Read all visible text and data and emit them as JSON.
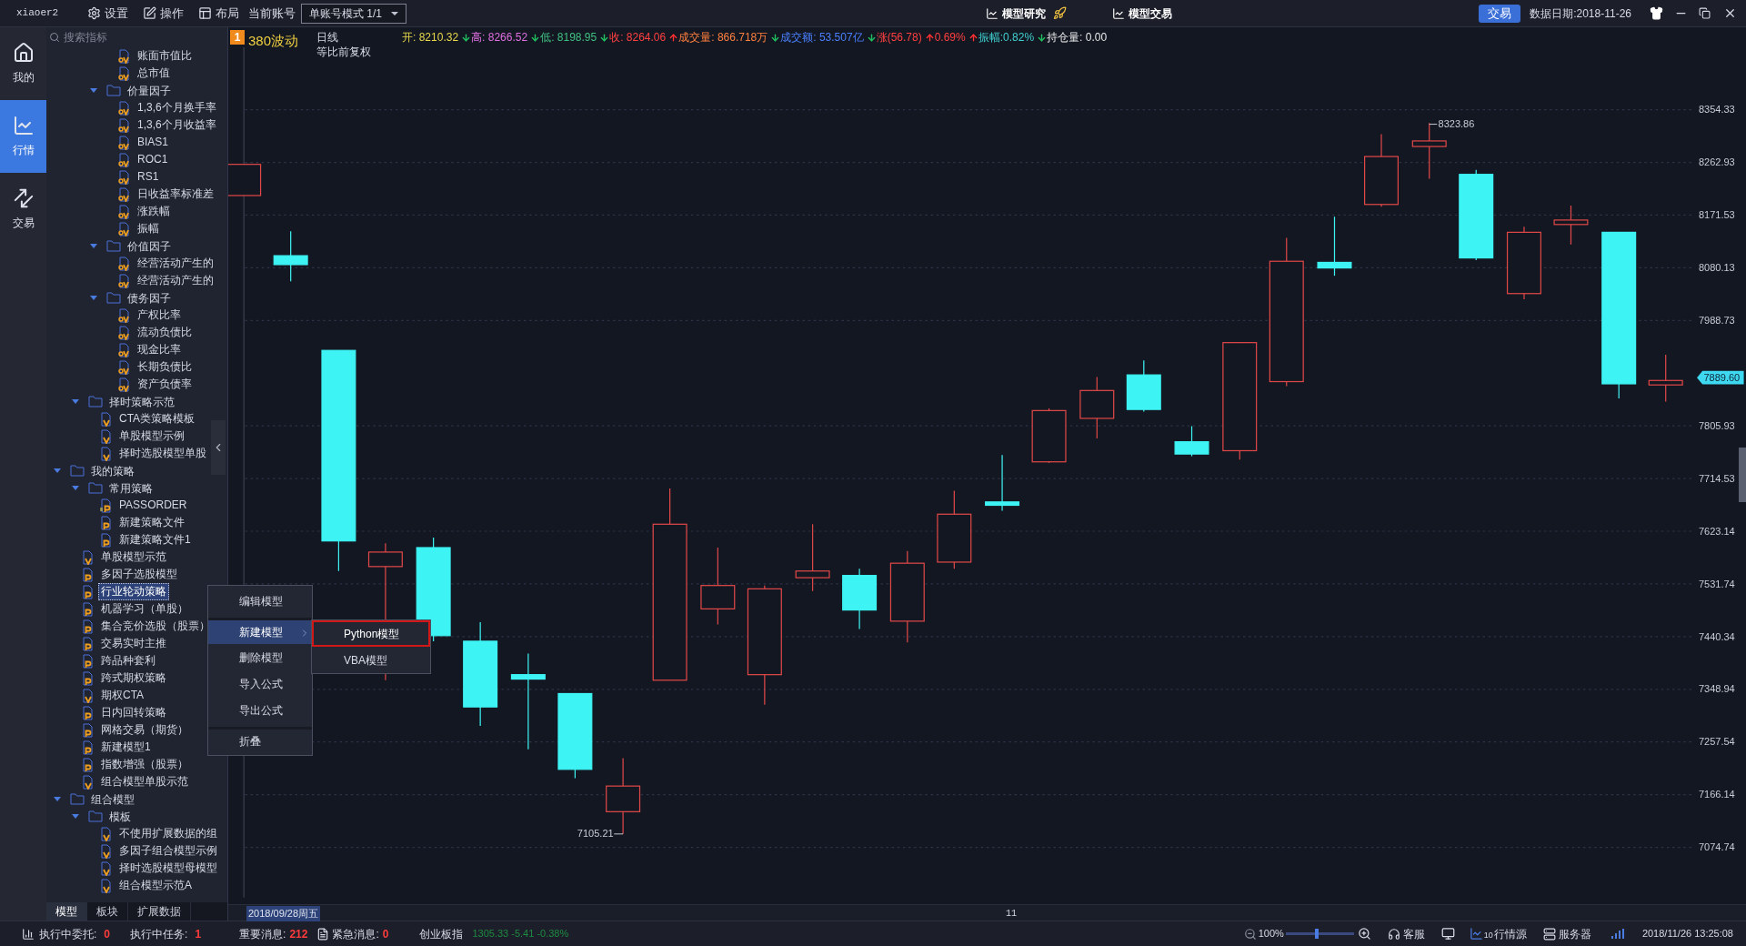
{
  "top_bar": {
    "user": "xiaoer2",
    "menus": [
      {
        "label": "设置"
      },
      {
        "label": "操作"
      },
      {
        "label": "布局"
      }
    ],
    "account_label": "当前账号",
    "account_select": "单账号模式 1/1",
    "center_tabs": [
      "模型研究",
      "模型交易"
    ],
    "trade_button": "交易",
    "data_date": "数据日期:2018-11-26"
  },
  "rail": [
    {
      "label": "我的",
      "selected": false
    },
    {
      "label": "行情",
      "selected": true
    },
    {
      "label": "交易",
      "selected": false
    }
  ],
  "tree": {
    "search_placeholder": "搜索指标",
    "items": [
      {
        "kind": "group",
        "children": [
          {
            "kind": "group",
            "children": [
              {
                "kind": "group",
                "children": [
                  {
                    "kind": "av",
                    "label": "账面市值比",
                    "selected": false
                  },
                  {
                    "kind": "av",
                    "label": "总市值",
                    "selected": false
                  }
                ]
              },
              {
                "kind": "folder",
                "label": "价量因子",
                "expanded": true,
                "children": [
                  {
                    "kind": "av",
                    "label": "1,3,6个月换手率",
                    "selected": false
                  },
                  {
                    "kind": "av",
                    "label": "1,3,6个月收益率",
                    "selected": false
                  },
                  {
                    "kind": "av",
                    "label": "BIAS1",
                    "selected": false
                  },
                  {
                    "kind": "av",
                    "label": "ROC1",
                    "selected": false
                  },
                  {
                    "kind": "av",
                    "label": "RS1",
                    "selected": false
                  },
                  {
                    "kind": "av",
                    "label": "日收益率标准差",
                    "selected": false
                  },
                  {
                    "kind": "av",
                    "label": "涨跌幅",
                    "selected": false
                  },
                  {
                    "kind": "av",
                    "label": "振幅",
                    "selected": false
                  }
                ]
              },
              {
                "kind": "folder",
                "label": "价值因子",
                "expanded": true,
                "children": [
                  {
                    "kind": "av",
                    "label": "经营活动产生的",
                    "selected": false
                  },
                  {
                    "kind": "av",
                    "label": "经营活动产生的",
                    "selected": false
                  }
                ]
              },
              {
                "kind": "folder",
                "label": "债务因子",
                "expanded": true,
                "children": [
                  {
                    "kind": "av",
                    "label": "产权比率",
                    "selected": false
                  },
                  {
                    "kind": "av",
                    "label": "流动负债比",
                    "selected": false
                  },
                  {
                    "kind": "av",
                    "label": "现金比率",
                    "selected": false
                  },
                  {
                    "kind": "av",
                    "label": "长期负债比",
                    "selected": false
                  },
                  {
                    "kind": "av",
                    "label": "资产负债率",
                    "selected": false
                  }
                ]
              }
            ]
          },
          {
            "kind": "folder",
            "label": "择时策略示范",
            "expanded": true,
            "children": [
              {
                "kind": "v",
                "label": "CTA类策略模板",
                "selected": false
              },
              {
                "kind": "v",
                "label": "单股模型示例",
                "selected": false
              },
              {
                "kind": "v",
                "label": "择时选股模型单股",
                "selected": false
              }
            ]
          }
        ]
      },
      {
        "kind": "folder",
        "label": "我的策略",
        "expanded": true,
        "children": [
          {
            "kind": "folder",
            "label": "常用策略",
            "expanded": true,
            "children": [
              {
                "kind": "pe",
                "label": "PASSORDER",
                "selected": false
              },
              {
                "kind": "p",
                "label": "新建策略文件",
                "selected": false
              },
              {
                "kind": "p",
                "label": "新建策略文件1",
                "selected": false
              }
            ]
          },
          {
            "kind": "v",
            "label": "单股模型示范",
            "selected": false
          },
          {
            "kind": "p",
            "label": "多因子选股模型",
            "selected": false
          },
          {
            "kind": "p",
            "label": "行业轮动策略",
            "selected": true
          },
          {
            "kind": "p",
            "label": "机器学习（单股）",
            "selected": false
          },
          {
            "kind": "p",
            "label": "集合竞价选股（股票）",
            "selected": false
          },
          {
            "kind": "p",
            "label": "交易实时主推",
            "selected": false
          },
          {
            "kind": "p",
            "label": "跨品种套利",
            "selected": false
          },
          {
            "kind": "p",
            "label": "跨式期权策略",
            "selected": false
          },
          {
            "kind": "v",
            "label": "期权CTA",
            "selected": false
          },
          {
            "kind": "p",
            "label": "日内回转策略",
            "selected": false
          },
          {
            "kind": "p",
            "label": "网格交易（期货）",
            "selected": false
          },
          {
            "kind": "p",
            "label": "新建模型1",
            "selected": false
          },
          {
            "kind": "p",
            "label": "指数增强（股票）",
            "selected": false
          },
          {
            "kind": "v",
            "label": "组合模型单股示范",
            "selected": false
          }
        ]
      },
      {
        "kind": "folder",
        "label": "组合模型",
        "expanded": true,
        "children": [
          {
            "kind": "folder",
            "label": "模板",
            "expanded": true,
            "children": [
              {
                "kind": "v",
                "label": "不使用扩展数据的组",
                "selected": false
              },
              {
                "kind": "v",
                "label": "多因子组合模型示例",
                "selected": false
              },
              {
                "kind": "v",
                "label": "择时选股模型母模型",
                "selected": false
              },
              {
                "kind": "v",
                "label": "组合模型示范A",
                "selected": false
              }
            ]
          }
        ]
      }
    ]
  },
  "tree_tabs": [
    {
      "label": "模型",
      "selected": true
    },
    {
      "label": "板块",
      "selected": false
    },
    {
      "label": "扩展数据",
      "selected": false
    }
  ],
  "context_menu": [
    {
      "label": "编辑模型",
      "selected": false,
      "has_submenu": false,
      "separator_before": false
    },
    {
      "label": "新建模型",
      "selected": true,
      "has_submenu": true,
      "separator_before": true
    },
    {
      "label": "删除模型",
      "selected": false,
      "has_submenu": false,
      "separator_before": false
    },
    {
      "label": "导入公式",
      "selected": false,
      "has_submenu": false,
      "separator_before": false
    },
    {
      "label": "导出公式",
      "selected": false,
      "has_submenu": false,
      "separator_before": false
    },
    {
      "label": "折叠",
      "selected": false,
      "has_submenu": false,
      "separator_before": true
    }
  ],
  "submenu": [
    {
      "label": "Python模型",
      "selected": true
    },
    {
      "label": "VBA模型",
      "selected": false
    }
  ],
  "chart": {
    "badge": "1",
    "name": "380波动",
    "period": "日线",
    "adjust": "等比前复权",
    "quote": [
      {
        "kind": "plain",
        "text": "开: 8210.32",
        "color": "#e8d84a"
      },
      {
        "kind": "down",
        "text": "高: 8266.52",
        "color": "#e070e0"
      },
      {
        "kind": "down",
        "text": "低: 8198.95",
        "color": "#40c080"
      },
      {
        "kind": "down",
        "text": "收: 8264.06",
        "color": "#ff4040"
      },
      {
        "kind": "up",
        "text": "成交量: 866.718万",
        "color": "#ff8040"
      },
      {
        "kind": "down",
        "text": "成交额: 53.507亿",
        "color": "#4a80ff"
      },
      {
        "kind": "down",
        "text": "涨(56.78)",
        "color": "#ff4040"
      },
      {
        "kind": "up",
        "text": "0.69%",
        "color": "#ff4040"
      },
      {
        "kind": "up",
        "text": "振幅:0.82%",
        "color": "#40d0d0"
      },
      {
        "kind": "down",
        "text": "持仓量: 0.00",
        "color": "#e8e8e8"
      }
    ],
    "price_ticks": [
      "8354.33",
      "8262.93",
      "8171.53",
      "8080.13",
      "7988.73",
      "7805.93",
      "7714.53",
      "7623.14",
      "7531.74",
      "7440.34",
      "7348.94",
      "7257.54",
      "7166.14",
      "7074.74"
    ],
    "high_label": "8323.86",
    "low_label": "7105.21",
    "last_price": "7889.60",
    "date_label": "2018/09/28周五",
    "x_tick": "11"
  },
  "status_bar": {
    "orders_label": "执行中委托:",
    "orders": "0",
    "tasks_label": "执行中任务:",
    "tasks": "1",
    "important_label": "重要消息:",
    "important": "212",
    "urgent_label": "紧急消息:",
    "urgent": "0",
    "index_name": "创业板指",
    "index_quote": "1305.33 -5.41 -0.38%",
    "zoom": "100%",
    "zoom_slider": {
      "level": 0.45
    },
    "service": "客服",
    "feed": "行情源",
    "feed_count": "10",
    "server": "服务器",
    "datetime": "2018/11/26 13:25:08"
  }
}
